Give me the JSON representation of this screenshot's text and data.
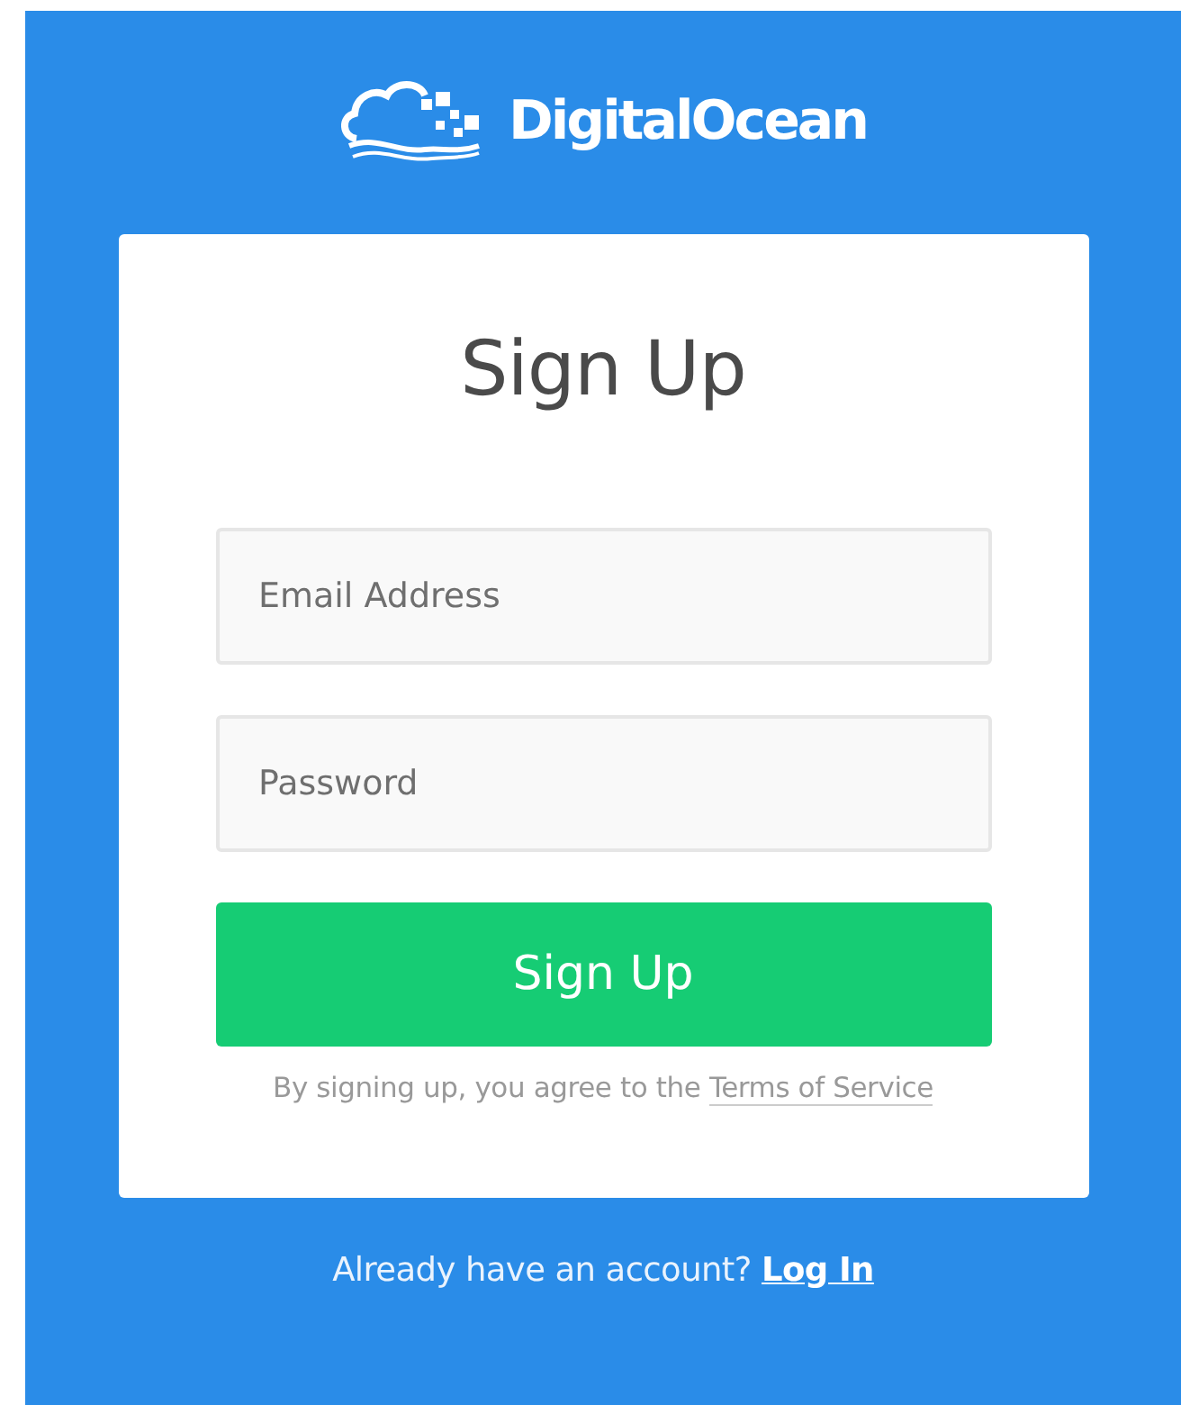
{
  "logo": {
    "text": "DigitalOcean"
  },
  "card": {
    "title": "Sign Up",
    "fields": [
      {
        "placeholder": "Email Address"
      },
      {
        "placeholder": "Password"
      }
    ],
    "submit": "Sign Up",
    "legal": {
      "text": "By signing up, you agree to the ",
      "link": "Terms of Service"
    }
  },
  "footer": {
    "text": "Already have an account? ",
    "link": "Log In"
  }
}
